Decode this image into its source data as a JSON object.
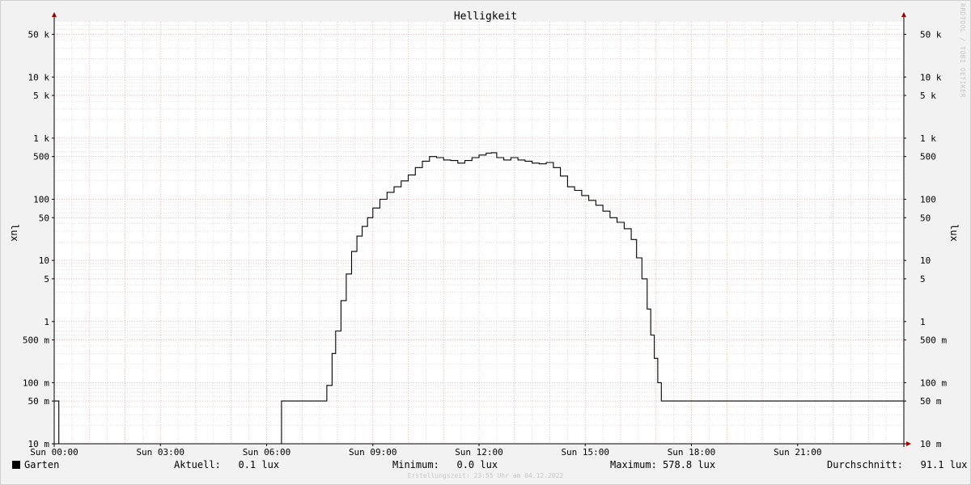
{
  "chart_data": {
    "type": "line",
    "title": "Helligkeit",
    "ylabel": "lux",
    "ylabel_right": "lux",
    "y_scale": "log",
    "ylim": [
      0.01,
      80000
    ],
    "x_range_hours": [
      0,
      24
    ],
    "grid": true,
    "legend": "bottom-left",
    "colors": {
      "series": "#000000",
      "major_grid": "#e3a0a0",
      "minor_grid": "#c8c8c8",
      "axis": "#000000",
      "arrow": "#a00000"
    },
    "y_ticks": [
      {
        "value": 50000,
        "label": "50 k"
      },
      {
        "value": 10000,
        "label": "10 k"
      },
      {
        "value": 5000,
        "label": "5 k"
      },
      {
        "value": 1000,
        "label": "1 k"
      },
      {
        "value": 500,
        "label": "500"
      },
      {
        "value": 100,
        "label": "100"
      },
      {
        "value": 50,
        "label": "50"
      },
      {
        "value": 10,
        "label": "10"
      },
      {
        "value": 5,
        "label": "5"
      },
      {
        "value": 1,
        "label": "1"
      },
      {
        "value": 0.5,
        "label": "500 m"
      },
      {
        "value": 0.1,
        "label": "100 m"
      },
      {
        "value": 0.05,
        "label": "50 m"
      },
      {
        "value": 0.01,
        "label": "10 m"
      }
    ],
    "x_ticks": [
      {
        "hour": 0,
        "label": "Sun 00:00"
      },
      {
        "hour": 3,
        "label": "Sun 03:00"
      },
      {
        "hour": 6,
        "label": "Sun 06:00"
      },
      {
        "hour": 9,
        "label": "Sun 09:00"
      },
      {
        "hour": 12,
        "label": "Sun 12:00"
      },
      {
        "hour": 15,
        "label": "Sun 15:00"
      },
      {
        "hour": 18,
        "label": "Sun 18:00"
      },
      {
        "hour": 21,
        "label": "Sun 21:00"
      }
    ],
    "series": [
      {
        "name": "Garten",
        "points": [
          [
            0.0,
            0.05
          ],
          [
            0.12,
            0.05
          ],
          [
            0.13,
            0.01
          ],
          [
            6.4,
            0.01
          ],
          [
            6.42,
            0.05
          ],
          [
            7.6,
            0.05
          ],
          [
            7.7,
            0.09
          ],
          [
            7.85,
            0.3
          ],
          [
            7.95,
            0.7
          ],
          [
            8.1,
            2.2
          ],
          [
            8.25,
            6
          ],
          [
            8.4,
            14
          ],
          [
            8.55,
            25
          ],
          [
            8.7,
            36
          ],
          [
            8.85,
            50
          ],
          [
            9.0,
            72
          ],
          [
            9.2,
            100
          ],
          [
            9.4,
            130
          ],
          [
            9.6,
            160
          ],
          [
            9.8,
            200
          ],
          [
            10.0,
            250
          ],
          [
            10.2,
            330
          ],
          [
            10.4,
            420
          ],
          [
            10.6,
            500
          ],
          [
            10.8,
            480
          ],
          [
            11.0,
            440
          ],
          [
            11.2,
            430
          ],
          [
            11.4,
            390
          ],
          [
            11.6,
            430
          ],
          [
            11.8,
            480
          ],
          [
            12.0,
            530
          ],
          [
            12.2,
            570
          ],
          [
            12.35,
            578.8
          ],
          [
            12.5,
            480
          ],
          [
            12.7,
            440
          ],
          [
            12.9,
            480
          ],
          [
            13.1,
            440
          ],
          [
            13.3,
            420
          ],
          [
            13.5,
            390
          ],
          [
            13.7,
            380
          ],
          [
            13.9,
            400
          ],
          [
            14.1,
            330
          ],
          [
            14.3,
            240
          ],
          [
            14.5,
            160
          ],
          [
            14.7,
            140
          ],
          [
            14.9,
            115
          ],
          [
            15.1,
            96
          ],
          [
            15.3,
            80
          ],
          [
            15.5,
            64
          ],
          [
            15.7,
            50
          ],
          [
            15.9,
            42
          ],
          [
            16.1,
            33
          ],
          [
            16.3,
            22
          ],
          [
            16.45,
            11
          ],
          [
            16.6,
            5
          ],
          [
            16.75,
            1.6
          ],
          [
            16.85,
            0.6
          ],
          [
            16.95,
            0.25
          ],
          [
            17.05,
            0.1
          ],
          [
            17.15,
            0.05
          ],
          [
            24.0,
            0.05
          ]
        ]
      }
    ]
  },
  "legend": {
    "series_name": "Garten",
    "current_label": "Aktuell:",
    "current_value": "0.1 lux",
    "min_label": "Minimum:",
    "min_value": "0.0 lux",
    "max_label": "Maximum:",
    "max_value": "578.8 lux",
    "avg_label": "Durchschnitt:",
    "avg_value": "91.1 lux"
  },
  "footer": "Erstellungszeit: 23:55 Uhr am 04.12.2022",
  "watermark": "RRDTOOL / TOBI OETIKER"
}
